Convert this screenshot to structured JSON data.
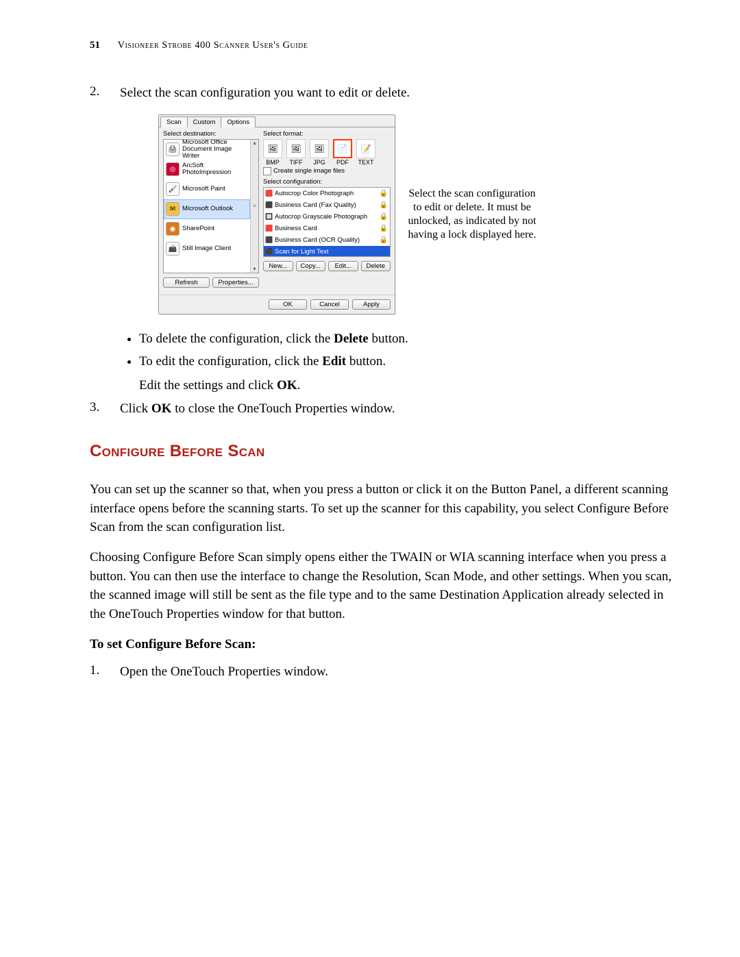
{
  "header": {
    "page_number": "51",
    "title": "Visioneer Strobe 400 Scanner User's Guide"
  },
  "step2": {
    "num": "2.",
    "text": "Select the scan configuration you want to edit or delete."
  },
  "dialog": {
    "tabs": {
      "t0": "Scan",
      "t1": "Custom",
      "t2": "Options"
    },
    "dest_label": "Select destination:",
    "dest": {
      "d0": "Microsoft Office Document Image Writer",
      "d1": "ArcSoft PhotoImpression",
      "d2": "Microsoft Paint",
      "d3": "Microsoft Outlook",
      "d4": "SharePoint",
      "d5": "Still Image Client"
    },
    "refresh": "Refresh",
    "properties": "Properties...",
    "fmt_label": "Select format:",
    "fmt": {
      "f0": "BMP",
      "f1": "TIFF",
      "f2": "JPG",
      "f3": "PDF",
      "f4": "TEXT"
    },
    "single_files": "Create single image files",
    "cfg_label": "Select configuration:",
    "cfg": {
      "c0": "Autocrop Color Photograph",
      "c1": "Business Card (Fax Quality)",
      "c2": "Autocrop Grayscale Photograph",
      "c3": "Business Card",
      "c4": "Business Card (OCR Quality)",
      "c5": "Scan for Light Text"
    },
    "btns": {
      "new": "New...",
      "copy": "Copy...",
      "edit": "Edit...",
      "delete": "Delete"
    },
    "bottom": {
      "ok": "OK",
      "cancel": "Cancel",
      "apply": "Apply"
    }
  },
  "callout": "Select the scan configuration to edit or delete. It must be unlocked, as indicated by not having a lock displayed here.",
  "bullets": {
    "b0a": "To delete the configuration, click the ",
    "b0b": "Delete",
    "b0c": " button.",
    "b1a": "To edit the configuration, click the ",
    "b1b": "Edit",
    "b1c": " button."
  },
  "editline_a": "Edit the settings and click ",
  "editline_b": "OK",
  "editline_c": ".",
  "step3": {
    "num": "3.",
    "a": "Click ",
    "b": "OK",
    "c": " to close the OneTouch Properties window."
  },
  "section_title": "Configure Before Scan",
  "para1": "You can set up the scanner so that, when you press a button or click it on the Button Panel, a different scanning interface opens before the scanning starts. To set up the scanner for this capability, you select Configure Before Scan from the scan configuration list.",
  "para2": "Choosing Configure Before Scan simply opens either the TWAIN or WIA scanning interface when you press a button. You can then use the interface to change the Resolution, Scan Mode, and other settings. When you scan, the scanned image will still be sent as the file type and to the same Destination Application already selected in the OneTouch Properties window for that button.",
  "subhead": "To set Configure Before Scan:",
  "ol1": {
    "num": "1.",
    "text": "Open the OneTouch Properties window."
  }
}
